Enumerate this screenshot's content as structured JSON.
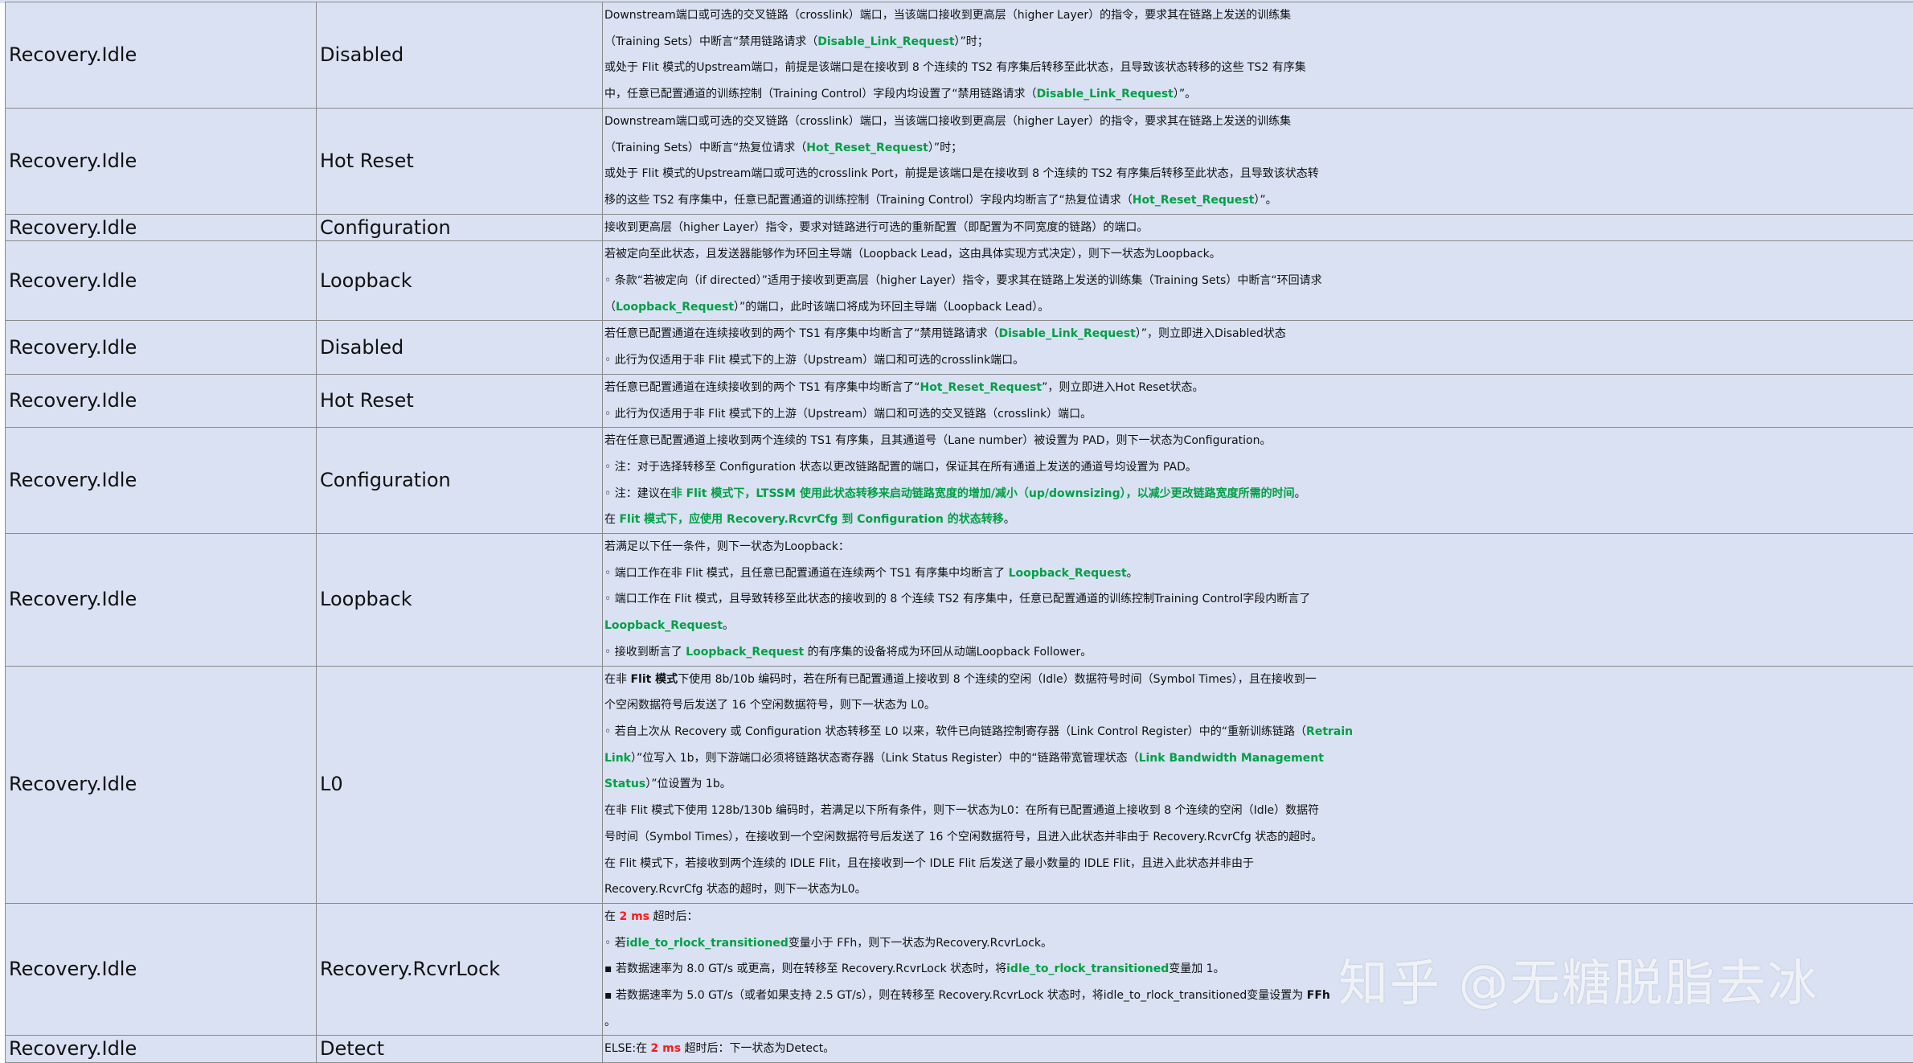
{
  "rows": [
    {
      "state": "Recovery.Idle",
      "next": "Disabled",
      "lines": [
        [
          {
            "t": "Downstream端口或可选的交叉链路（crosslink）端口，当该端口接收到更高层（higher Layer）的指令，要求其在链路上发送的训练集"
          }
        ],
        [
          {
            "t": "（Training Sets）中断言“禁用链路请求（"
          },
          {
            "t": "Disable_Link_Request",
            "s": "g"
          },
          {
            "t": "）”时；"
          }
        ],
        [
          {
            "t": "或处于 Flit 模式的Upstream端口，前提是该端口是在接收到 8 个连续的 TS2 有序集后转移至此状态，且导致该状态转移的这些 TS2 有序集"
          }
        ],
        [
          {
            "t": "中，任意已配置通道的训练控制（Training Control）字段内均设置了“禁用链路请求（"
          },
          {
            "t": "Disable_Link_Request",
            "s": "g"
          },
          {
            "t": "）”。"
          }
        ]
      ]
    },
    {
      "state": "Recovery.Idle",
      "next": "Hot Reset",
      "lines": [
        [
          {
            "t": "Downstream端口或可选的交叉链路（crosslink）端口，当该端口接收到更高层（higher Layer）的指令，要求其在链路上发送的训练集"
          }
        ],
        [
          {
            "t": "（Training Sets）中断言“热复位请求（"
          },
          {
            "t": "Hot_Reset_Request",
            "s": "g"
          },
          {
            "t": "）”时；"
          }
        ],
        [
          {
            "t": "或处于 Flit 模式的Upstream端口或可选的crosslink Port，前提是该端口是在接收到 8 个连续的 TS2 有序集后转移至此状态，且导致该状态转"
          }
        ],
        [
          {
            "t": "移的这些 TS2 有序集中，任意已配置通道的训练控制（Training Control）字段内均断言了“热复位请求（"
          },
          {
            "t": "Hot_Reset_Request",
            "s": "g"
          },
          {
            "t": "）”。"
          }
        ]
      ]
    },
    {
      "state": "Recovery.Idle",
      "next": "Configuration",
      "lines": [
        [
          {
            "t": "接收到更高层（higher Layer）指令，要求对链路进行可选的重新配置（即配置为不同宽度的链路）的端口。"
          }
        ]
      ]
    },
    {
      "state": "Recovery.Idle",
      "next": "Loopback",
      "lines": [
        [
          {
            "t": "若被定向至此状态，且发送器能够作为环回主导端（Loopback Lead，这由具体实现方式决定），则下一状态为Loopback。"
          }
        ],
        [
          {
            "t": "◦ 条款“若被定向（if directed）”适用于接收到更高层（higher Layer）指令，要求其在链路上发送的训练集（Training Sets）中断言“环回请求"
          }
        ],
        [
          {
            "t": "（"
          },
          {
            "t": "Loopback_Request",
            "s": "g"
          },
          {
            "t": "）”的端口，此时该端口将成为环回主导端（Loopback Lead）。"
          }
        ]
      ]
    },
    {
      "state": "Recovery.Idle",
      "next": "Disabled",
      "lines": [
        [
          {
            "t": "若任意已配置通道在连续接收到的两个 TS1 有序集中均断言了“禁用链路请求（"
          },
          {
            "t": "Disable_Link_Request",
            "s": "g"
          },
          {
            "t": "）”，则立即进入Disabled状态"
          }
        ],
        [
          {
            "t": "◦ 此行为仅适用于非 Flit 模式下的上游（Upstream）端口和可选的crosslink端口。"
          }
        ]
      ]
    },
    {
      "state": "Recovery.Idle",
      "next": "Hot Reset",
      "lines": [
        [
          {
            "t": "若任意已配置通道在连续接收到的两个 TS1 有序集中均断言了“"
          },
          {
            "t": "Hot_Reset_Request",
            "s": "g"
          },
          {
            "t": "”，则立即进入Hot Reset状态。"
          }
        ],
        [
          {
            "t": "◦ 此行为仅适用于非 Flit 模式下的上游（Upstream）端口和可选的交叉链路（crosslink）端口。"
          }
        ]
      ]
    },
    {
      "state": "Recovery.Idle",
      "next": "Configuration",
      "lines": [
        [
          {
            "t": "若在任意已配置通道上接收到两个连续的 TS1 有序集，且其通道号（Lane number）被设置为 PAD，则下一状态为Configuration。"
          }
        ],
        [
          {
            "t": "◦ 注：对于选择转移至 Configuration 状态以更改链路配置的端口，保证其在所有通道上发送的通道号均设置为 PAD。"
          }
        ],
        [
          {
            "t": "◦ 注：建议在"
          },
          {
            "t": "非 Flit 模式下，LTSSM 使用此状态转移来启动链路宽度的增加/减小（up/downsizing），以减少更改链路宽度所需的时间",
            "s": "g"
          },
          {
            "t": "。"
          }
        ],
        [
          {
            "t": "在 "
          },
          {
            "t": "Flit 模式下，应使用 Recovery.RcvrCfg 到 Configuration 的状态转移",
            "s": "g"
          },
          {
            "t": "。"
          }
        ]
      ]
    },
    {
      "state": "Recovery.Idle",
      "next": "Loopback",
      "lines": [
        [
          {
            "t": "若满足以下任一条件，则下一状态为Loopback："
          }
        ],
        [
          {
            "t": "◦ 端口工作在非 Flit 模式，且任意已配置通道在连续两个 TS1 有序集中均断言了 "
          },
          {
            "t": "Loopback_Request",
            "s": "g"
          },
          {
            "t": "。"
          }
        ],
        [
          {
            "t": "◦ 端口工作在 Flit 模式，且导致转移至此状态的接收到的 8 个连续 TS2 有序集中，任意已配置通道的训练控制Training Control字段内断言了"
          }
        ],
        [
          {
            "t": "Loopback_Request",
            "s": "g"
          },
          {
            "t": "。"
          }
        ],
        [
          {
            "t": "◦ 接收到断言了 "
          },
          {
            "t": "Loopback_Request",
            "s": "g"
          },
          {
            "t": " 的有序集的设备将成为环回从动端Loopback Follower。"
          }
        ]
      ]
    },
    {
      "state": "Recovery.Idle",
      "next": "L0",
      "lines": [
        [
          {
            "t": "在非 "
          },
          {
            "t": "Flit 模式",
            "s": "b"
          },
          {
            "t": "下使用 8b/10b 编码时，若在所有已配置通道上接收到 8 个连续的空闲（Idle）数据符号时间（Symbol Times），且在接收到一"
          }
        ],
        [
          {
            "t": "个空闲数据符号后发送了 16 个空闲数据符号，则下一状态为 L0。"
          }
        ],
        [
          {
            "t": "◦ 若自上次从 Recovery 或 Configuration 状态转移至 L0 以来，软件已向链路控制寄存器（Link Control Register）中的“重新训练链路（"
          },
          {
            "t": "Retrain",
            "s": "g"
          }
        ],
        [
          {
            "t": "Link",
            "s": "g"
          },
          {
            "t": "）”位写入 1b，则下游端口必须将链路状态寄存器（Link Status Register）中的“链路带宽管理状态（"
          },
          {
            "t": "Link Bandwidth Management",
            "s": "g"
          }
        ],
        [
          {
            "t": "Status",
            "s": "g"
          },
          {
            "t": "）”位设置为 1b。"
          }
        ],
        [
          {
            "t": "在非 Flit 模式下使用 128b/130b 编码时，若满足以下所有条件，则下一状态为L0：在所有已配置通道上接收到 8 个连续的空闲（Idle）数据符"
          }
        ],
        [
          {
            "t": "号时间（Symbol Times），在接收到一个空闲数据符号后发送了 16 个空闲数据符号，且进入此状态并非由于 Recovery.RcvrCfg 状态的超时。"
          }
        ],
        [
          {
            "t": "在 Flit 模式下，若接收到两个连续的 IDLE Flit，且在接收到一个 IDLE Flit 后发送了最小数量的 IDLE Flit，且进入此状态并非由于"
          }
        ],
        [
          {
            "t": "Recovery.RcvrCfg 状态的超时，则下一状态为L0。"
          }
        ]
      ]
    },
    {
      "state": "Recovery.Idle",
      "next": "Recovery.RcvrLock",
      "lines": [
        [
          {
            "t": "在 "
          },
          {
            "t": "2 ms",
            "s": "r"
          },
          {
            "t": " 超时后："
          }
        ],
        [
          {
            "t": "◦ 若"
          },
          {
            "t": "idle_to_rlock_transitioned",
            "s": "g"
          },
          {
            "t": "变量小于 FFh，则下一状态为Recovery.RcvrLock。"
          }
        ],
        [
          {
            "t": "▪ 若数据速率为 8.0 GT/s 或更高，则在转移至 Recovery.RcvrLock 状态时，将"
          },
          {
            "t": "idle_to_rlock_transitioned",
            "s": "g"
          },
          {
            "t": "变量加 1。"
          }
        ],
        [
          {
            "t": "▪ 若数据速率为 5.0 GT/s（或者如果支持 2.5 GT/s），则在转移至 Recovery.RcvrLock 状态时，将idle_to_rlock_transitioned变量设置为 "
          },
          {
            "t": "FFh",
            "s": "b"
          }
        ],
        [
          {
            "t": "。"
          }
        ]
      ]
    },
    {
      "state": "Recovery.Idle",
      "next": "Detect",
      "lines": [
        [
          {
            "t": "ELSE:在 "
          },
          {
            "t": "2 ms",
            "s": "r"
          },
          {
            "t": " 超时后：下一状态为Detect。"
          }
        ]
      ]
    }
  ],
  "watermark": "知乎 @无糖脱脂去冰"
}
